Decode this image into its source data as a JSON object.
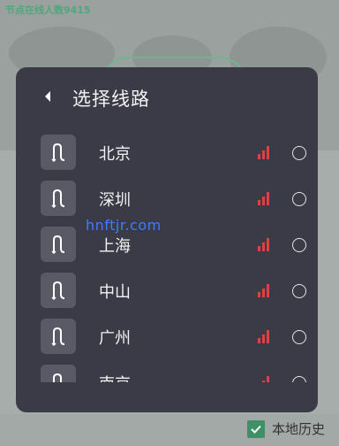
{
  "background": {
    "node_count_text": "节点在线人数9415",
    "local_history_label": "本地历史",
    "local_history_checked": true
  },
  "modal": {
    "title": "选择线路",
    "routes": [
      {
        "label": "北京",
        "icon": "route-switch-icon",
        "signal": "signal-bars-icon"
      },
      {
        "label": "深圳",
        "icon": "route-switch-icon",
        "signal": "signal-bars-icon"
      },
      {
        "label": "上海",
        "icon": "route-switch-icon",
        "signal": "signal-bars-icon"
      },
      {
        "label": "中山",
        "icon": "route-switch-icon",
        "signal": "signal-bars-icon"
      },
      {
        "label": "广州",
        "icon": "route-switch-icon",
        "signal": "signal-bars-icon"
      },
      {
        "label": "南京",
        "icon": "route-switch-icon",
        "signal": "signal-bars-icon"
      }
    ]
  },
  "watermark": "hnftjr.com",
  "colors": {
    "modal_bg": "#3b3a47",
    "accent_green": "#4fa77c",
    "signal_red": "#e04040"
  }
}
